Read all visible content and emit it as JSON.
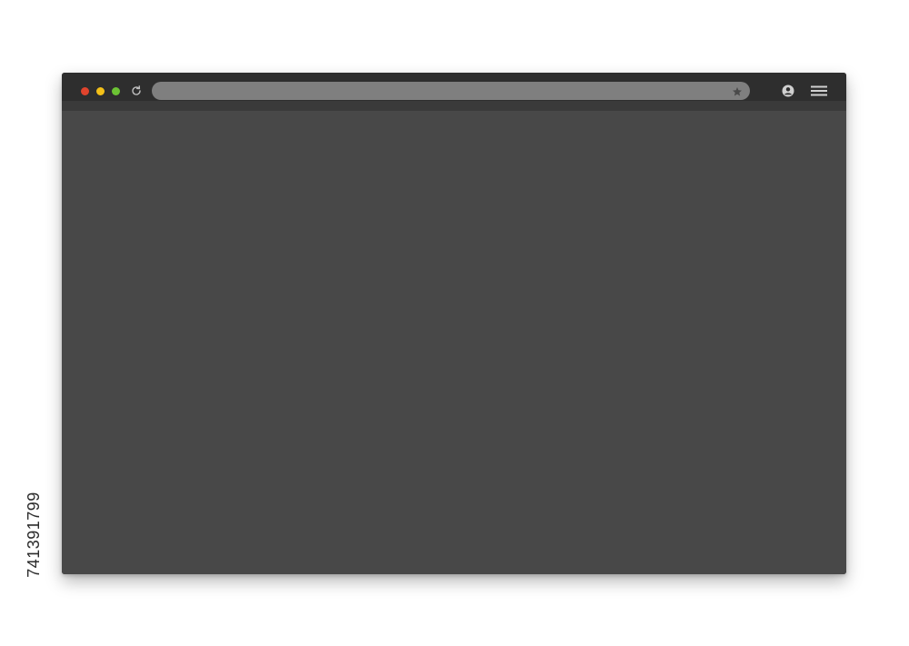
{
  "watermark": {
    "stock_id": "741391799"
  },
  "browser": {
    "colors": {
      "close": "#e0442d",
      "minimize": "#f3c018",
      "maximize": "#6cc334",
      "toolbar": "#2e2e2e",
      "address_bar": "#7f7f7f",
      "viewport": "#484848",
      "icon": "#bdbdbd"
    },
    "icons": {
      "close": "close-dot-icon",
      "minimize": "minimize-dot-icon",
      "maximize": "maximize-dot-icon",
      "reload": "reload-icon",
      "bookmark": "star-icon",
      "account": "account-icon",
      "menu": "hamburger-menu-icon"
    },
    "address": {
      "value": ""
    }
  }
}
